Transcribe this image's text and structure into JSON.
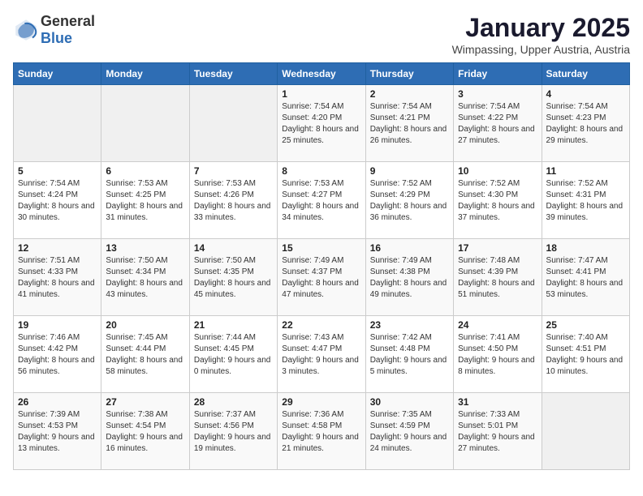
{
  "header": {
    "logo_general": "General",
    "logo_blue": "Blue",
    "month_title": "January 2025",
    "location": "Wimpassing, Upper Austria, Austria"
  },
  "days_of_week": [
    "Sunday",
    "Monday",
    "Tuesday",
    "Wednesday",
    "Thursday",
    "Friday",
    "Saturday"
  ],
  "weeks": [
    [
      {
        "day": "",
        "info": ""
      },
      {
        "day": "",
        "info": ""
      },
      {
        "day": "",
        "info": ""
      },
      {
        "day": "1",
        "info": "Sunrise: 7:54 AM\nSunset: 4:20 PM\nDaylight: 8 hours and 25 minutes."
      },
      {
        "day": "2",
        "info": "Sunrise: 7:54 AM\nSunset: 4:21 PM\nDaylight: 8 hours and 26 minutes."
      },
      {
        "day": "3",
        "info": "Sunrise: 7:54 AM\nSunset: 4:22 PM\nDaylight: 8 hours and 27 minutes."
      },
      {
        "day": "4",
        "info": "Sunrise: 7:54 AM\nSunset: 4:23 PM\nDaylight: 8 hours and 29 minutes."
      }
    ],
    [
      {
        "day": "5",
        "info": "Sunrise: 7:54 AM\nSunset: 4:24 PM\nDaylight: 8 hours and 30 minutes."
      },
      {
        "day": "6",
        "info": "Sunrise: 7:53 AM\nSunset: 4:25 PM\nDaylight: 8 hours and 31 minutes."
      },
      {
        "day": "7",
        "info": "Sunrise: 7:53 AM\nSunset: 4:26 PM\nDaylight: 8 hours and 33 minutes."
      },
      {
        "day": "8",
        "info": "Sunrise: 7:53 AM\nSunset: 4:27 PM\nDaylight: 8 hours and 34 minutes."
      },
      {
        "day": "9",
        "info": "Sunrise: 7:52 AM\nSunset: 4:29 PM\nDaylight: 8 hours and 36 minutes."
      },
      {
        "day": "10",
        "info": "Sunrise: 7:52 AM\nSunset: 4:30 PM\nDaylight: 8 hours and 37 minutes."
      },
      {
        "day": "11",
        "info": "Sunrise: 7:52 AM\nSunset: 4:31 PM\nDaylight: 8 hours and 39 minutes."
      }
    ],
    [
      {
        "day": "12",
        "info": "Sunrise: 7:51 AM\nSunset: 4:33 PM\nDaylight: 8 hours and 41 minutes."
      },
      {
        "day": "13",
        "info": "Sunrise: 7:50 AM\nSunset: 4:34 PM\nDaylight: 8 hours and 43 minutes."
      },
      {
        "day": "14",
        "info": "Sunrise: 7:50 AM\nSunset: 4:35 PM\nDaylight: 8 hours and 45 minutes."
      },
      {
        "day": "15",
        "info": "Sunrise: 7:49 AM\nSunset: 4:37 PM\nDaylight: 8 hours and 47 minutes."
      },
      {
        "day": "16",
        "info": "Sunrise: 7:49 AM\nSunset: 4:38 PM\nDaylight: 8 hours and 49 minutes."
      },
      {
        "day": "17",
        "info": "Sunrise: 7:48 AM\nSunset: 4:39 PM\nDaylight: 8 hours and 51 minutes."
      },
      {
        "day": "18",
        "info": "Sunrise: 7:47 AM\nSunset: 4:41 PM\nDaylight: 8 hours and 53 minutes."
      }
    ],
    [
      {
        "day": "19",
        "info": "Sunrise: 7:46 AM\nSunset: 4:42 PM\nDaylight: 8 hours and 56 minutes."
      },
      {
        "day": "20",
        "info": "Sunrise: 7:45 AM\nSunset: 4:44 PM\nDaylight: 8 hours and 58 minutes."
      },
      {
        "day": "21",
        "info": "Sunrise: 7:44 AM\nSunset: 4:45 PM\nDaylight: 9 hours and 0 minutes."
      },
      {
        "day": "22",
        "info": "Sunrise: 7:43 AM\nSunset: 4:47 PM\nDaylight: 9 hours and 3 minutes."
      },
      {
        "day": "23",
        "info": "Sunrise: 7:42 AM\nSunset: 4:48 PM\nDaylight: 9 hours and 5 minutes."
      },
      {
        "day": "24",
        "info": "Sunrise: 7:41 AM\nSunset: 4:50 PM\nDaylight: 9 hours and 8 minutes."
      },
      {
        "day": "25",
        "info": "Sunrise: 7:40 AM\nSunset: 4:51 PM\nDaylight: 9 hours and 10 minutes."
      }
    ],
    [
      {
        "day": "26",
        "info": "Sunrise: 7:39 AM\nSunset: 4:53 PM\nDaylight: 9 hours and 13 minutes."
      },
      {
        "day": "27",
        "info": "Sunrise: 7:38 AM\nSunset: 4:54 PM\nDaylight: 9 hours and 16 minutes."
      },
      {
        "day": "28",
        "info": "Sunrise: 7:37 AM\nSunset: 4:56 PM\nDaylight: 9 hours and 19 minutes."
      },
      {
        "day": "29",
        "info": "Sunrise: 7:36 AM\nSunset: 4:58 PM\nDaylight: 9 hours and 21 minutes."
      },
      {
        "day": "30",
        "info": "Sunrise: 7:35 AM\nSunset: 4:59 PM\nDaylight: 9 hours and 24 minutes."
      },
      {
        "day": "31",
        "info": "Sunrise: 7:33 AM\nSunset: 5:01 PM\nDaylight: 9 hours and 27 minutes."
      },
      {
        "day": "",
        "info": ""
      }
    ]
  ]
}
